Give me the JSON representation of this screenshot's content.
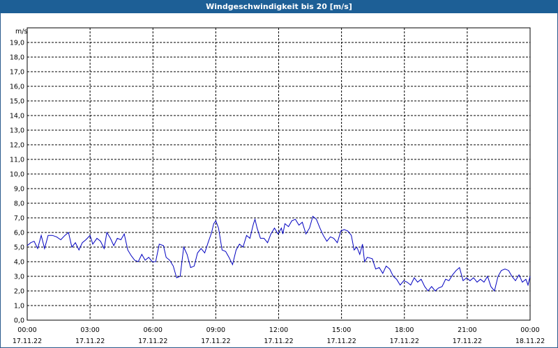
{
  "window": {
    "title": "Windgeschwindigkeit bis 20 [m/s]"
  },
  "colors": {
    "title_bg": "#1d5f96",
    "line": "#0000c0",
    "grid": "#000000"
  },
  "chart_data": {
    "type": "line",
    "title": "Windgeschwindigkeit bis 20 [m/s]",
    "ylabel": "m/s",
    "ylim": [
      0,
      20
    ],
    "y_ticks": [
      "0,0",
      "1,0",
      "2,0",
      "3,0",
      "4,0",
      "5,0",
      "6,0",
      "7,0",
      "8,0",
      "9,0",
      "10,0",
      "11,0",
      "12,0",
      "13,0",
      "14,0",
      "15,0",
      "16,0",
      "17,0",
      "18,0",
      "19,0"
    ],
    "x_range_hours": [
      0,
      24
    ],
    "x_ticks": [
      {
        "time": "00:00",
        "date": "17.11.22"
      },
      {
        "time": "03:00",
        "date": "17.11.22"
      },
      {
        "time": "06:00",
        "date": "17.11.22"
      },
      {
        "time": "09:00",
        "date": "17.11.22"
      },
      {
        "time": "12:00",
        "date": "17.11.22"
      },
      {
        "time": "15:00",
        "date": "17.11.22"
      },
      {
        "time": "18:00",
        "date": "17.11.22"
      },
      {
        "time": "21:00",
        "date": "17.11.22"
      },
      {
        "time": "00:00",
        "date": "18.11.22"
      }
    ],
    "grid": true,
    "series": [
      {
        "values": [
          [
            0.0,
            5.1
          ],
          [
            0.17,
            5.3
          ],
          [
            0.33,
            5.4
          ],
          [
            0.5,
            4.9
          ],
          [
            0.67,
            5.8
          ],
          [
            0.83,
            4.9
          ],
          [
            1.0,
            5.8
          ],
          [
            1.2,
            5.8
          ],
          [
            1.4,
            5.7
          ],
          [
            1.6,
            5.5
          ],
          [
            1.8,
            5.8
          ],
          [
            1.97,
            6.0
          ],
          [
            2.13,
            5.0
          ],
          [
            2.3,
            5.3
          ],
          [
            2.47,
            4.8
          ],
          [
            2.63,
            5.3
          ],
          [
            2.8,
            5.5
          ],
          [
            3.0,
            5.8
          ],
          [
            3.13,
            5.2
          ],
          [
            3.33,
            5.6
          ],
          [
            3.5,
            5.4
          ],
          [
            3.67,
            4.9
          ],
          [
            3.8,
            6.0
          ],
          [
            3.97,
            5.6
          ],
          [
            4.13,
            5.1
          ],
          [
            4.3,
            5.6
          ],
          [
            4.47,
            5.5
          ],
          [
            4.63,
            5.9
          ],
          [
            4.8,
            4.8
          ],
          [
            4.97,
            4.4
          ],
          [
            5.13,
            4.1
          ],
          [
            5.3,
            4.0
          ],
          [
            5.47,
            4.5
          ],
          [
            5.63,
            4.1
          ],
          [
            5.8,
            4.3
          ],
          [
            5.97,
            4.0
          ],
          [
            6.13,
            4.0
          ],
          [
            6.3,
            5.2
          ],
          [
            6.5,
            5.1
          ],
          [
            6.63,
            4.3
          ],
          [
            6.8,
            4.1
          ],
          [
            6.97,
            3.7
          ],
          [
            7.13,
            2.9
          ],
          [
            7.3,
            3.0
          ],
          [
            7.47,
            5.0
          ],
          [
            7.63,
            4.5
          ],
          [
            7.8,
            3.6
          ],
          [
            7.97,
            3.7
          ],
          [
            8.13,
            4.6
          ],
          [
            8.3,
            4.9
          ],
          [
            8.47,
            4.6
          ],
          [
            8.63,
            5.3
          ],
          [
            8.8,
            6.0
          ],
          [
            8.9,
            6.6
          ],
          [
            9.0,
            6.8
          ],
          [
            9.13,
            6.3
          ],
          [
            9.3,
            4.8
          ],
          [
            9.47,
            4.7
          ],
          [
            9.63,
            4.3
          ],
          [
            9.8,
            3.8
          ],
          [
            9.97,
            4.8
          ],
          [
            10.13,
            5.2
          ],
          [
            10.3,
            5.0
          ],
          [
            10.47,
            5.8
          ],
          [
            10.63,
            5.6
          ],
          [
            10.8,
            6.6
          ],
          [
            10.87,
            6.9
          ],
          [
            10.97,
            6.3
          ],
          [
            11.13,
            5.6
          ],
          [
            11.3,
            5.6
          ],
          [
            11.47,
            5.3
          ],
          [
            11.63,
            5.9
          ],
          [
            11.8,
            6.3
          ],
          [
            11.97,
            5.9
          ],
          [
            12.13,
            6.3
          ],
          [
            12.2,
            5.9
          ],
          [
            12.3,
            6.6
          ],
          [
            12.47,
            6.4
          ],
          [
            12.63,
            6.8
          ],
          [
            12.8,
            6.9
          ],
          [
            12.97,
            6.5
          ],
          [
            13.13,
            6.7
          ],
          [
            13.3,
            5.9
          ],
          [
            13.47,
            6.3
          ],
          [
            13.63,
            7.1
          ],
          [
            13.8,
            6.9
          ],
          [
            13.97,
            6.3
          ],
          [
            14.13,
            5.8
          ],
          [
            14.3,
            5.4
          ],
          [
            14.47,
            5.7
          ],
          [
            14.63,
            5.6
          ],
          [
            14.8,
            5.3
          ],
          [
            14.97,
            6.1
          ],
          [
            15.13,
            6.2
          ],
          [
            15.3,
            6.1
          ],
          [
            15.47,
            5.8
          ],
          [
            15.6,
            4.8
          ],
          [
            15.73,
            5.0
          ],
          [
            15.87,
            4.5
          ],
          [
            16.0,
            5.2
          ],
          [
            16.1,
            4.0
          ],
          [
            16.23,
            4.3
          ],
          [
            16.47,
            4.2
          ],
          [
            16.63,
            3.5
          ],
          [
            16.8,
            3.6
          ],
          [
            16.97,
            3.2
          ],
          [
            17.13,
            3.7
          ],
          [
            17.3,
            3.5
          ],
          [
            17.47,
            3.0
          ],
          [
            17.63,
            2.8
          ],
          [
            17.8,
            2.4
          ],
          [
            17.97,
            2.7
          ],
          [
            18.13,
            2.6
          ],
          [
            18.3,
            2.4
          ],
          [
            18.47,
            2.9
          ],
          [
            18.63,
            2.6
          ],
          [
            18.8,
            2.8
          ],
          [
            18.97,
            2.3
          ],
          [
            19.13,
            2.0
          ],
          [
            19.3,
            2.3
          ],
          [
            19.47,
            2.0
          ],
          [
            19.63,
            2.2
          ],
          [
            19.8,
            2.3
          ],
          [
            19.97,
            2.8
          ],
          [
            20.13,
            2.7
          ],
          [
            20.3,
            3.1
          ],
          [
            20.47,
            3.4
          ],
          [
            20.63,
            3.6
          ],
          [
            20.8,
            2.7
          ],
          [
            20.97,
            2.9
          ],
          [
            21.13,
            2.7
          ],
          [
            21.3,
            2.9
          ],
          [
            21.47,
            2.6
          ],
          [
            21.63,
            2.8
          ],
          [
            21.8,
            2.6
          ],
          [
            21.97,
            3.0
          ],
          [
            22.13,
            2.3
          ],
          [
            22.3,
            2.0
          ],
          [
            22.47,
            3.0
          ],
          [
            22.63,
            3.4
          ],
          [
            22.8,
            3.5
          ],
          [
            22.97,
            3.4
          ],
          [
            23.13,
            3.0
          ],
          [
            23.3,
            2.7
          ],
          [
            23.47,
            3.1
          ],
          [
            23.63,
            2.6
          ],
          [
            23.8,
            2.8
          ],
          [
            23.9,
            2.4
          ],
          [
            24.0,
            3.0
          ]
        ]
      }
    ]
  }
}
